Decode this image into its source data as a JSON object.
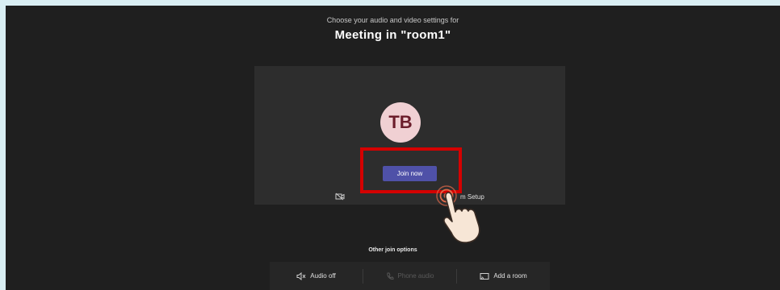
{
  "header": {
    "subtitle": "Choose your audio and video settings for",
    "title": "Meeting in \"room1\""
  },
  "preview": {
    "avatar_initials": "TB",
    "join_label": "Join now",
    "device_setup_label": "m Setup"
  },
  "other_options": {
    "label": "Other join options",
    "items": [
      {
        "label": "Audio off",
        "icon": "speaker-off-icon",
        "enabled": true
      },
      {
        "label": "Phone audio",
        "icon": "phone-icon",
        "enabled": false
      },
      {
        "label": "Add a room",
        "icon": "cast-icon",
        "enabled": true
      }
    ]
  },
  "colors": {
    "background": "#1f1f1f",
    "join_button": "#4f51a8",
    "highlight": "#d40000",
    "avatar_bg": "#f0d0d3",
    "avatar_text": "#6b1d2b"
  }
}
